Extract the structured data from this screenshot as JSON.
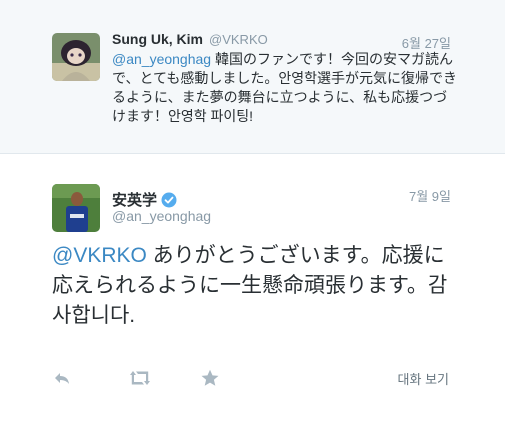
{
  "reply_tweet": {
    "fullname": "Sung Uk, Kim",
    "screen_name": "@VKRKO",
    "time": "6월 27일",
    "mention": "@an_yeonghag",
    "text": " 韓国のファンです！今回の安マガ読んで、とても感動しました。안영학選手が元気に復帰できるように、また夢の舞台に立つように、私も応援つづけます！안영학 파이팅!"
  },
  "main_tweet": {
    "fullname": "安英学",
    "screen_name": "@an_yeonghag",
    "time": "7월 9일",
    "mention": "@VKRKO",
    "text": " ありがとうございます。応援に応えられるように一生懸命頑張ります。감사합니다.",
    "verified": true,
    "verified_color": "#55acee"
  },
  "actions": {
    "reply_icon": "reply-icon",
    "retweet_icon": "retweet-icon",
    "favorite_icon": "star-icon",
    "view_conversation": "대화 보기"
  }
}
